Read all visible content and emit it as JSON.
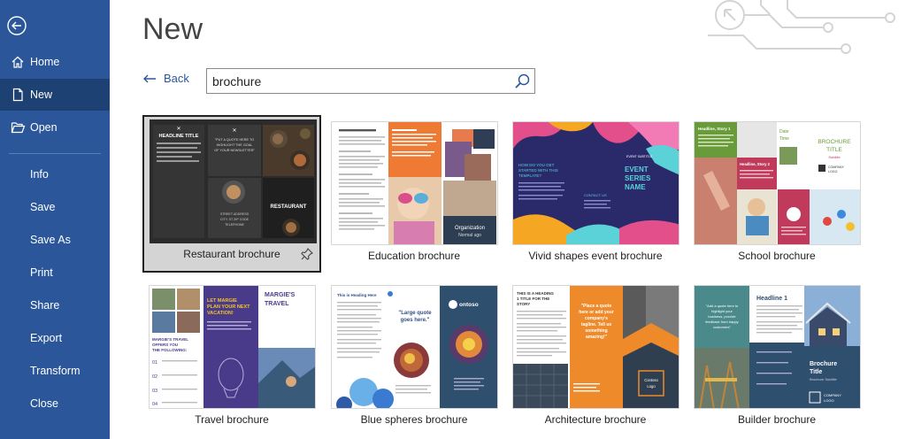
{
  "nav": {
    "items": [
      {
        "label": "Home",
        "icon": "home-icon"
      },
      {
        "label": "New",
        "icon": "new-document-icon"
      },
      {
        "label": "Open",
        "icon": "folder-open-icon"
      },
      {
        "label": "Info"
      },
      {
        "label": "Save"
      },
      {
        "label": "Save As"
      },
      {
        "label": "Print"
      },
      {
        "label": "Share"
      },
      {
        "label": "Export"
      },
      {
        "label": "Transform"
      },
      {
        "label": "Close"
      }
    ],
    "active": "New"
  },
  "page": {
    "title": "New"
  },
  "toolbar": {
    "back_label": "Back"
  },
  "search": {
    "value": "brochure"
  },
  "templates": [
    {
      "label": "Restaurant brochure",
      "selected": true,
      "thumb_text": [
        "HEADLINE TITLE",
        "\"PUT A QUOTE HERE TO HIGHLIGHT THE GOAL OF YOUR NEWSLETTER\"",
        "RESTAURANT",
        "STREET ADDRESS CITY, ST ZIP CODE TELEPHONE"
      ]
    },
    {
      "label": "Education brochure",
      "thumb_text": [
        "Organization Name",
        "Organization Normal ugo"
      ]
    },
    {
      "label": "Vivid shapes event brochure",
      "thumb_text": [
        "HOW DO YOU GET STARTED WITH THIS TEMPLATE?",
        "EVENT SUBTITLE",
        "EVENT SERIES NAME",
        "CONTACT US"
      ]
    },
    {
      "label": "School brochure",
      "thumb_text": [
        "Headline, Story 1",
        "Headline, Story 2",
        "BROCHURE TITLE",
        "Subtitle",
        "Date",
        "Time",
        "COMPANY LOGO"
      ]
    },
    {
      "label": "Travel brochure",
      "thumb_text": [
        "LET MARGIE PLAN YOUR NEXT VACATION!",
        "MARGIE'S TRAVEL",
        "MARGIE'S TRAVEL OFFERS YOU THE FOLLOWING:",
        "01",
        "02",
        "03",
        "04"
      ]
    },
    {
      "label": "Blue spheres brochure",
      "thumb_text": [
        "This is Heading Here",
        "\"Large quote goes here.\"",
        "Contoso"
      ]
    },
    {
      "label": "Architecture brochure",
      "thumb_text": [
        "THIS IS A HEADING 1 TITLE FOR THE STORY",
        "\"Place a quote here or add your company's tagline. Tell us something amazing!\"",
        "Contoso Logo"
      ]
    },
    {
      "label": "Builder brochure",
      "thumb_text": [
        "Headline 1",
        "Brochure Title",
        "Brochure Subtitle",
        "COMPANY LOGO"
      ]
    }
  ],
  "colors": {
    "sidebar": "#2b579a",
    "sidebar_active": "#1e4173",
    "accent_link": "#2b579a"
  }
}
